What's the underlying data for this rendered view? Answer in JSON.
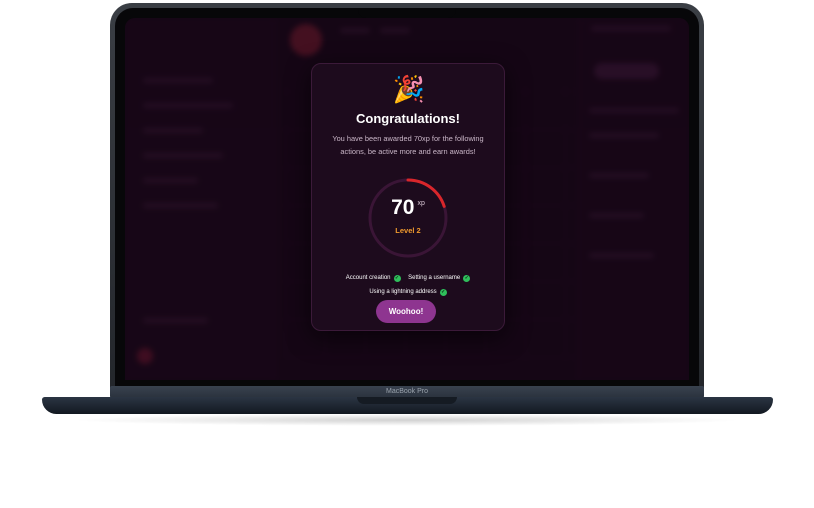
{
  "device": {
    "model_label": "MacBook Pro"
  },
  "modal": {
    "icon": "party-popper-icon",
    "title": "Congratulations!",
    "description": "You have been awarded 70xp for the following actions, be active more and earn awards!",
    "xp_value": "70",
    "xp_unit": "xp",
    "level": "Level 2",
    "level_progress": 0.2,
    "actions": [
      {
        "label": "Account creation",
        "completed": true
      },
      {
        "label": "Setting a username",
        "completed": true
      },
      {
        "label": "Using a lightning address",
        "completed": true
      }
    ],
    "button_label": "Woohoo!"
  },
  "colors": {
    "accent": "#8e3590",
    "progress": "#d9262b",
    "level": "#f09a2e",
    "check": "#2fbf5b",
    "background": "#1c0b1c"
  }
}
